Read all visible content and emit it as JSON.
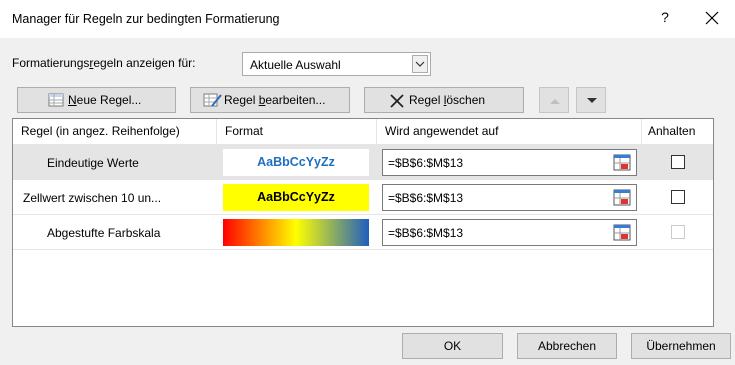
{
  "window": {
    "title": "Manager für Regeln zur bedingten Formatierung",
    "help_label": "?",
    "close_label": "×"
  },
  "show_rules": {
    "label_before": "Formatierungs",
    "label_underlined": "r",
    "label_after": "egeln anzeigen für:",
    "selected": "Aktuelle Auswahl"
  },
  "toolbar": {
    "new_rule_underlined": "N",
    "new_rule_rest": "eue Regel...",
    "edit_rule_before": "Regel ",
    "edit_rule_underlined": "b",
    "edit_rule_after": "earbeiten...",
    "delete_rule_before": "Regel ",
    "delete_rule_underlined": "l",
    "delete_rule_after": "öschen"
  },
  "table": {
    "headers": {
      "rule": "Regel (in angez. Reihenfolge)",
      "format": "Format",
      "applies_to": "Wird angewendet auf",
      "stop": "Anhalten"
    },
    "rows": [
      {
        "name": "Eindeutige Werte",
        "preview": "AaBbCcYyZz",
        "range": "=$B$6:$M$13"
      },
      {
        "name": "Zellwert zwischen 10 un...",
        "preview": "AaBbCcYyZz",
        "range": "=$B$6:$M$13"
      },
      {
        "name": "Abgestufte Farbskala",
        "preview": "",
        "range": "=$B$6:$M$13"
      }
    ]
  },
  "buttons": {
    "ok": "OK",
    "cancel": "Abbrechen",
    "apply": "Übernehmen"
  },
  "colors": {
    "preview1_text": "#1f6fbf",
    "preview2_bg": "#ffff00",
    "scale_low": "#ff0000",
    "scale_mid": "#ffff00",
    "scale_high": "#1f5fbf"
  }
}
